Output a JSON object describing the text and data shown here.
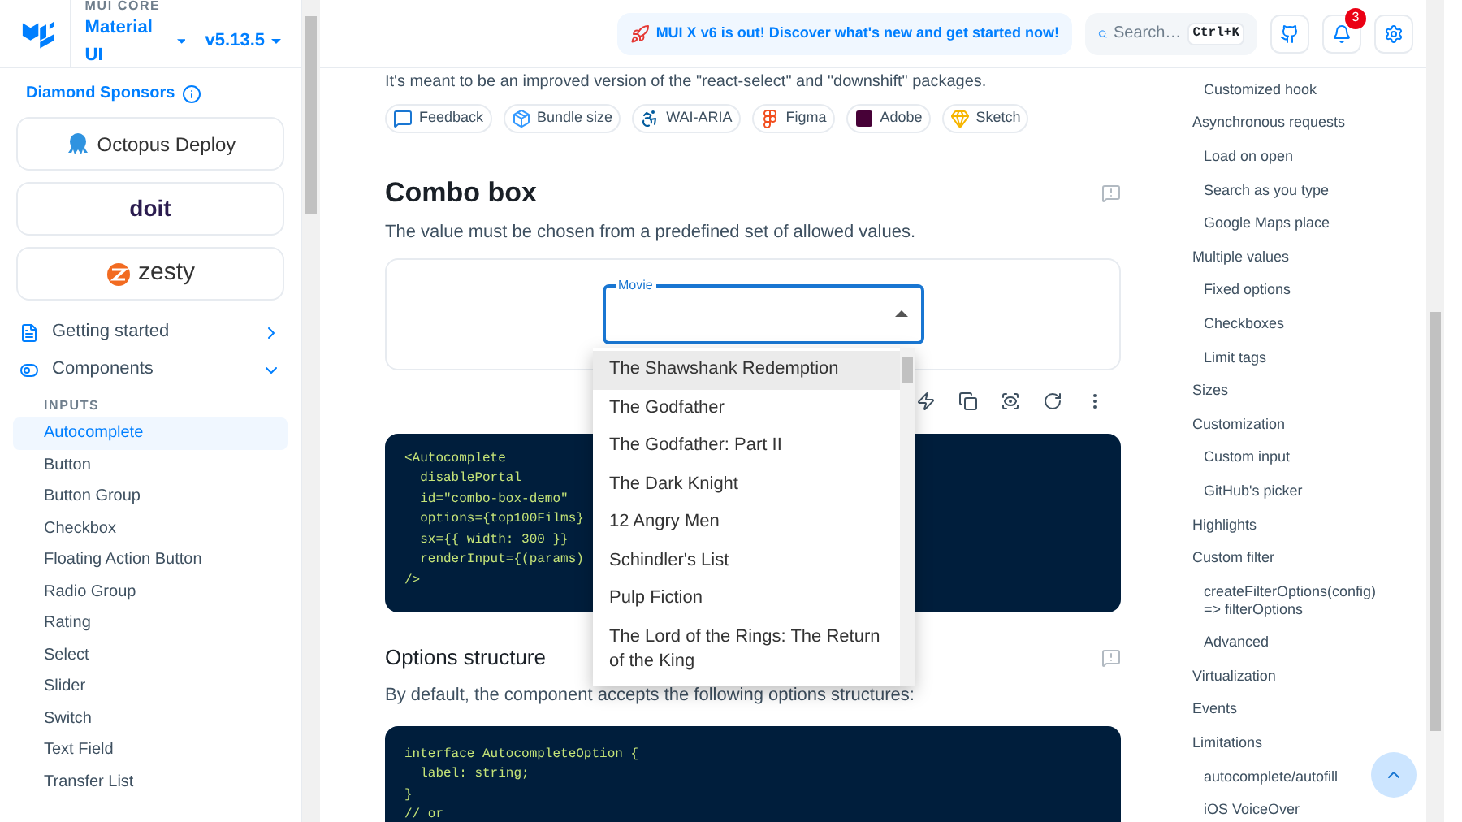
{
  "header": {
    "banner": "MUI X v6 is out! Discover what's new and get started now!",
    "search": {
      "placeholder": "Search…",
      "shortcut": "Ctrl+K"
    },
    "notification_count": "3"
  },
  "sidebar": {
    "brand": "MUI CORE",
    "product": "Material UI",
    "version": "v5.13.5",
    "sponsors_title": "Diamond Sponsors",
    "sponsors": [
      "Octopus Deploy",
      "doit",
      "zesty"
    ],
    "nav": [
      {
        "label": "Getting started",
        "expanded": false
      },
      {
        "label": "Components",
        "expanded": true
      }
    ],
    "section": "INPUTS",
    "items": [
      {
        "label": "Autocomplete",
        "selected": true
      },
      {
        "label": "Button",
        "selected": false
      },
      {
        "label": "Button Group",
        "selected": false
      },
      {
        "label": "Checkbox",
        "selected": false
      },
      {
        "label": "Floating Action Button",
        "selected": false
      },
      {
        "label": "Radio Group",
        "selected": false
      },
      {
        "label": "Rating",
        "selected": false
      },
      {
        "label": "Select",
        "selected": false
      },
      {
        "label": "Slider",
        "selected": false
      },
      {
        "label": "Switch",
        "selected": false
      },
      {
        "label": "Text Field",
        "selected": false
      },
      {
        "label": "Transfer List",
        "selected": false
      }
    ]
  },
  "content": {
    "intro": "It's meant to be an improved version of the \"react-select\" and \"downshift\" packages.",
    "chips": [
      "Feedback",
      "Bundle size",
      "WAI-ARIA",
      "Figma",
      "Adobe",
      "Sketch"
    ],
    "heading": "Combo box",
    "description": "The value must be chosen from a predefined set of allowed values.",
    "demo": {
      "label": "Movie",
      "options": [
        {
          "label": "The Shawshank Redemption",
          "selected": true
        },
        {
          "label": "The Godfather",
          "selected": false
        },
        {
          "label": "The Godfather: Part II",
          "selected": false
        },
        {
          "label": "The Dark Knight",
          "selected": false
        },
        {
          "label": "12 Angry Men",
          "selected": false
        },
        {
          "label": "Schindler's List",
          "selected": false
        },
        {
          "label": "Pulp Fiction",
          "selected": false
        },
        {
          "label": "The Lord of the Rings: The Return of the King",
          "selected": false
        }
      ]
    },
    "code_1": [
      "<Autocomplete",
      "  disablePortal",
      "  id=\"combo-box-demo\"",
      "  options={top100Films}",
      "  sx={{ width: 300 }}",
      "  renderInput={(params)",
      "/>"
    ],
    "heading_2": "Options structure",
    "description_2": "By default, the component accepts the following options structures:",
    "code_2": [
      "interface AutocompleteOption {",
      "  label: string;",
      "}",
      "// or"
    ]
  },
  "toc": [
    {
      "label": "Customized hook"
    },
    {
      "label": "Asynchronous requests",
      "children": [
        "Load on open",
        "Search as you type",
        "Google Maps place"
      ]
    },
    {
      "label": "Multiple values",
      "children": [
        "Fixed options",
        "Checkboxes",
        "Limit tags"
      ]
    },
    {
      "label": "Sizes"
    },
    {
      "label": "Customization",
      "children": [
        "Custom input",
        "GitHub's picker"
      ]
    },
    {
      "label": "Highlights"
    },
    {
      "label": "Custom filter",
      "children": [
        "createFilterOptions(config) => filterOptions",
        "Advanced"
      ]
    },
    {
      "label": "Virtualization"
    },
    {
      "label": "Events"
    },
    {
      "label": "Limitations",
      "children": [
        "autocomplete/autofill",
        "iOS VoiceOver"
      ]
    }
  ]
}
